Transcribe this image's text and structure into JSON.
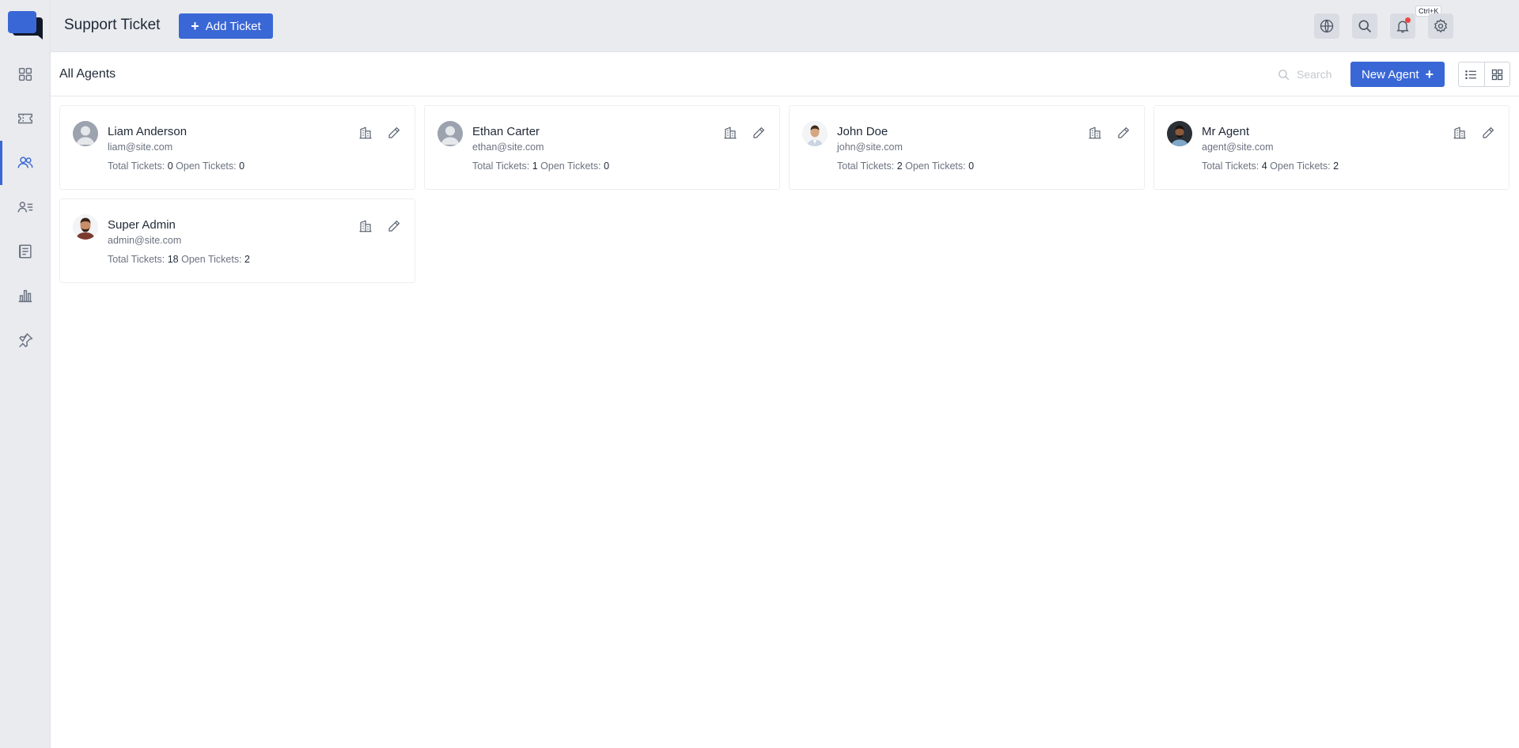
{
  "app": {
    "title": "Support Ticket",
    "add_ticket_label": "Add Ticket"
  },
  "header": {
    "search_shortcut": "Ctrl+K"
  },
  "sidebar": {
    "items": [
      {
        "name": "dashboard",
        "icon": "grid-icon"
      },
      {
        "name": "tickets",
        "icon": "ticket-icon"
      },
      {
        "name": "agents",
        "icon": "users-icon",
        "active": true
      },
      {
        "name": "contacts",
        "icon": "contact-list-icon"
      },
      {
        "name": "knowledge-base",
        "icon": "document-icon"
      },
      {
        "name": "reports",
        "icon": "bar-chart-icon"
      },
      {
        "name": "pinned",
        "icon": "pin-icon"
      }
    ]
  },
  "page": {
    "title": "All Agents",
    "search_placeholder": "Search",
    "new_agent_label": "New Agent"
  },
  "agents": [
    {
      "name": "Liam Anderson",
      "email": "liam@site.com",
      "total_label": "Total Tickets:",
      "total": "0",
      "open_label": "Open Tickets:",
      "open": "0",
      "avatar": "placeholder"
    },
    {
      "name": "Ethan Carter",
      "email": "ethan@site.com",
      "total_label": "Total Tickets:",
      "total": "1",
      "open_label": "Open Tickets:",
      "open": "0",
      "avatar": "placeholder"
    },
    {
      "name": "John Doe",
      "email": "john@site.com",
      "total_label": "Total Tickets:",
      "total": "2",
      "open_label": "Open Tickets:",
      "open": "0",
      "avatar": "photo"
    },
    {
      "name": "Mr Agent",
      "email": "agent@site.com",
      "total_label": "Total Tickets:",
      "total": "4",
      "open_label": "Open Tickets:",
      "open": "2",
      "avatar": "photo"
    },
    {
      "name": "Super Admin",
      "email": "admin@site.com",
      "total_label": "Total Tickets:",
      "total": "18",
      "open_label": "Open Tickets:",
      "open": "2",
      "avatar": "photo"
    }
  ],
  "colors": {
    "accent": "#3a67d6",
    "sidebar_bg": "#e9ebef",
    "notification": "#ef4444"
  }
}
